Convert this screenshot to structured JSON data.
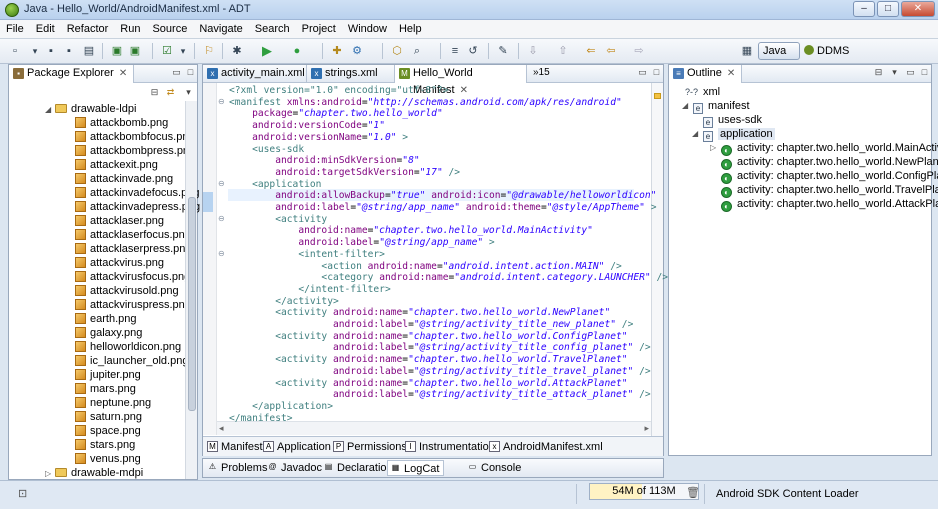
{
  "window": {
    "title": "Java - Hello_World/AndroidManifest.xml - ADT"
  },
  "menu": [
    "File",
    "Edit",
    "Refactor",
    "Run",
    "Source",
    "Navigate",
    "Search",
    "Project",
    "Window",
    "Help"
  ],
  "perspectives": {
    "java": "Java",
    "ddms": "DDMS"
  },
  "package_explorer": {
    "tab_label": "Package Explorer",
    "folder": "drawable-ldpi",
    "files": [
      "attackbomb.png",
      "attackbombfocus.png",
      "attackbombpress.png",
      "attackexit.png",
      "attackinvade.png",
      "attackinvadefocus.png",
      "attackinvadepress.png",
      "attacklaser.png",
      "attacklaserfocus.png",
      "attacklaserpress.png",
      "attackvirus.png",
      "attackvirusfocus.png",
      "attackvirusold.png",
      "attackviruspress.png",
      "earth.png",
      "galaxy.png",
      "helloworldicon.png",
      "ic_launcher_old.png",
      "jupiter.png",
      "mars.png",
      "neptune.png",
      "saturn.png",
      "space.png",
      "stars.png",
      "venus.png"
    ],
    "next_folder": "drawable-mdpi"
  },
  "editor": {
    "tabs": [
      "activity_main.xml",
      "strings.xml",
      "Hello_World Manifest"
    ],
    "overflow": "»15",
    "lines": [
      [
        [
          "pi",
          "<?xml version=\"1.0\" encoding=\"utf-8\"?>"
        ]
      ],
      [
        [
          "tag",
          "<manifest "
        ],
        [
          "attr",
          "xmlns:android"
        ],
        [
          "t",
          "="
        ],
        [
          "val",
          "\"http://schemas.android.com/apk/res/android\""
        ]
      ],
      [
        [
          "t",
          "    "
        ],
        [
          "attr",
          "package"
        ],
        [
          "t",
          "="
        ],
        [
          "val",
          "\"chapter.two.hello_world\""
        ]
      ],
      [
        [
          "t",
          "    "
        ],
        [
          "attr",
          "android:versionCode"
        ],
        [
          "t",
          "="
        ],
        [
          "val",
          "\"1\""
        ]
      ],
      [
        [
          "t",
          "    "
        ],
        [
          "attr",
          "android:versionName"
        ],
        [
          "t",
          "="
        ],
        [
          "val",
          "\"1.0\""
        ],
        [
          "tag",
          " >"
        ]
      ],
      [
        [
          "t",
          "    "
        ],
        [
          "tag",
          "<uses-sdk"
        ]
      ],
      [
        [
          "t",
          "        "
        ],
        [
          "attr",
          "android:minSdkVersion"
        ],
        [
          "t",
          "="
        ],
        [
          "val",
          "\"8\""
        ]
      ],
      [
        [
          "t",
          "        "
        ],
        [
          "attr",
          "android:targetSdkVersion"
        ],
        [
          "t",
          "="
        ],
        [
          "val",
          "\"17\""
        ],
        [
          "tag",
          " />"
        ]
      ],
      [
        [
          "t",
          "    "
        ],
        [
          "tag",
          "<application"
        ]
      ],
      [
        [
          "t",
          "        "
        ],
        [
          "attr",
          "android:allowBackup"
        ],
        [
          "t",
          "="
        ],
        [
          "val",
          "\"true\""
        ],
        [
          "t",
          " "
        ],
        [
          "attr",
          "android:icon"
        ],
        [
          "t",
          "="
        ],
        [
          "val",
          "\"@drawable/helloworldicon\""
        ]
      ],
      [
        [
          "t",
          "        "
        ],
        [
          "attr",
          "android:label"
        ],
        [
          "t",
          "="
        ],
        [
          "val",
          "\"@string/app_name\""
        ],
        [
          "t",
          " "
        ],
        [
          "attr",
          "android:theme"
        ],
        [
          "t",
          "="
        ],
        [
          "val",
          "\"@style/AppTheme\""
        ],
        [
          "tag",
          " >"
        ]
      ],
      [
        [
          "t",
          "        "
        ],
        [
          "tag",
          "<activity"
        ]
      ],
      [
        [
          "t",
          "            "
        ],
        [
          "attr",
          "android:name"
        ],
        [
          "t",
          "="
        ],
        [
          "val",
          "\"chapter.two.hello_world.MainActivity\""
        ]
      ],
      [
        [
          "t",
          "            "
        ],
        [
          "attr",
          "android:label"
        ],
        [
          "t",
          "="
        ],
        [
          "val",
          "\"@string/app_name\""
        ],
        [
          "tag",
          " >"
        ]
      ],
      [
        [
          "t",
          "            "
        ],
        [
          "tag",
          "<intent-filter>"
        ]
      ],
      [
        [
          "t",
          "                "
        ],
        [
          "tag",
          "<action "
        ],
        [
          "attr",
          "android:name"
        ],
        [
          "t",
          "="
        ],
        [
          "val",
          "\"android.intent.action.MAIN\""
        ],
        [
          "tag",
          " />"
        ]
      ],
      [
        [
          "t",
          "                "
        ],
        [
          "tag",
          "<category "
        ],
        [
          "attr",
          "android:name"
        ],
        [
          "t",
          "="
        ],
        [
          "val",
          "\"android.intent.category.LAUNCHER\""
        ],
        [
          "tag",
          " />"
        ]
      ],
      [
        [
          "t",
          "            "
        ],
        [
          "tag",
          "</intent-filter>"
        ]
      ],
      [
        [
          "t",
          "        "
        ],
        [
          "tag",
          "</activity>"
        ]
      ],
      [
        [
          "t",
          "        "
        ],
        [
          "tag",
          "<activity "
        ],
        [
          "attr",
          "android:name"
        ],
        [
          "t",
          "="
        ],
        [
          "val",
          "\"chapter.two.hello_world.NewPlanet\""
        ]
      ],
      [
        [
          "t",
          "                  "
        ],
        [
          "attr",
          "android:label"
        ],
        [
          "t",
          "="
        ],
        [
          "val",
          "\"@string/activity_title_new_planet\""
        ],
        [
          "tag",
          " />"
        ]
      ],
      [
        [
          "t",
          "        "
        ],
        [
          "tag",
          "<activity "
        ],
        [
          "attr",
          "android:name"
        ],
        [
          "t",
          "="
        ],
        [
          "val",
          "\"chapter.two.hello_world.ConfigPlanet\""
        ]
      ],
      [
        [
          "t",
          "                  "
        ],
        [
          "attr",
          "android:label"
        ],
        [
          "t",
          "="
        ],
        [
          "val",
          "\"@string/activity_title_config_planet\""
        ],
        [
          "tag",
          " />"
        ]
      ],
      [
        [
          "t",
          "        "
        ],
        [
          "tag",
          "<activity "
        ],
        [
          "attr",
          "android:name"
        ],
        [
          "t",
          "="
        ],
        [
          "val",
          "\"chapter.two.hello_world.TravelPlanet\""
        ]
      ],
      [
        [
          "t",
          "                  "
        ],
        [
          "attr",
          "android:label"
        ],
        [
          "t",
          "="
        ],
        [
          "val",
          "\"@string/activity_title_travel_planet\""
        ],
        [
          "tag",
          " />"
        ]
      ],
      [
        [
          "t",
          "        "
        ],
        [
          "tag",
          "<activity "
        ],
        [
          "attr",
          "android:name"
        ],
        [
          "t",
          "="
        ],
        [
          "val",
          "\"chapter.two.hello_world.AttackPlanet\""
        ]
      ],
      [
        [
          "t",
          "                  "
        ],
        [
          "attr",
          "android:label"
        ],
        [
          "t",
          "="
        ],
        [
          "val",
          "\"@string/activity_title_attack_planet\""
        ],
        [
          "tag",
          " />"
        ]
      ],
      [
        [
          "t",
          "    "
        ],
        [
          "tag",
          "</application>"
        ]
      ],
      [
        [
          "tag",
          "</manifest>"
        ]
      ]
    ],
    "bottom_tabs": [
      "Manifest",
      "Application",
      "Permissions",
      "Instrumentation",
      "AndroidManifest.xml"
    ]
  },
  "outline": {
    "tab_label": "Outline",
    "items": [
      {
        "icon": "?-?",
        "label": "xml"
      },
      {
        "icon": "e",
        "label": "manifest"
      },
      {
        "icon": "e",
        "label": "uses-sdk"
      },
      {
        "icon": "e",
        "label": "application"
      },
      {
        "icon": "A",
        "label": "activity: chapter.two.hello_world.MainActivity"
      },
      {
        "icon": "A",
        "label": "activity: chapter.two.hello_world.NewPlanet"
      },
      {
        "icon": "A",
        "label": "activity: chapter.two.hello_world.ConfigPlanet"
      },
      {
        "icon": "A",
        "label": "activity: chapter.two.hello_world.TravelPlanet"
      },
      {
        "icon": "A",
        "label": "activity: chapter.two.hello_world.AttackPlanet"
      }
    ]
  },
  "console_tabs": [
    "Problems",
    "Javadoc",
    "Declaration",
    "LogCat",
    "Console"
  ],
  "status": {
    "heap": "54M of 113M",
    "heap_fraction": 0.48,
    "loader": "Android SDK Content Loader"
  }
}
